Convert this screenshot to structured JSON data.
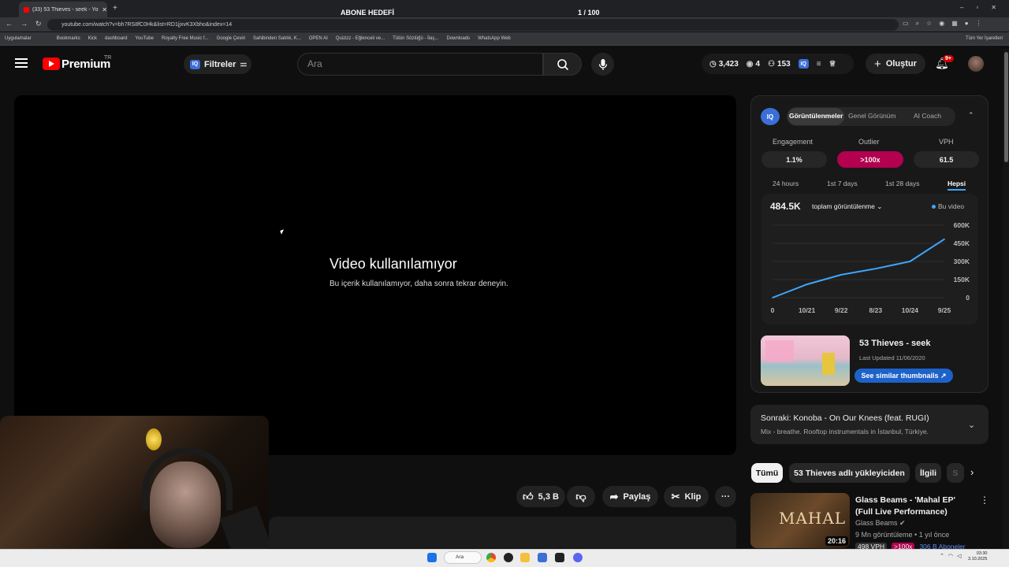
{
  "browser": {
    "tab_title": "(33) 53 Thieves - seek - YouTube",
    "url": "youtube.com/watch?v=bh7RS8fC0Hk&list=RD1jjxvK3Xbho&index=14",
    "bookmarks": [
      "Uygulamalar",
      "Bookmarks",
      "Kick",
      "dashboard",
      "YouTube",
      "Royalty Free Music f...",
      "Google Çeviri",
      "Sahibinden Satılık, K...",
      "OPEN AI",
      "Quizizz - Eğlenceli ve...",
      "Tütün Sözlüğü - İlaç...",
      "Downloads",
      "WhatsApp Web"
    ],
    "all_bookmarks": "Tüm Yer İşaretleri"
  },
  "overlay": {
    "title": "ABONE HEDEFİ",
    "count": "1  / 100",
    "progress": 0.01
  },
  "header": {
    "logo_text": "Premium",
    "region": "TR",
    "filters_label": "Filtreler",
    "iq_badge": "IQ",
    "search_placeholder": "Ara",
    "stats": {
      "views": "3,423",
      "eye": "4",
      "count": "153"
    },
    "create_label": "Oluştur",
    "notifications": "9+"
  },
  "player": {
    "title": "Video kullanılamıyor",
    "subtitle": "Bu içerik kullanılamıyor, daha sonra tekrar deneyin."
  },
  "actions": {
    "likes": "5,3 B",
    "share": "Paylaş",
    "clip": "Klip",
    "more": "···"
  },
  "iq_panel": {
    "logo": "IQ",
    "tabs": [
      "Görüntülenmeler",
      "Genel Görünüm",
      "AI Coach"
    ],
    "metrics": [
      {
        "label": "Engagement",
        "value": "1.1%"
      },
      {
        "label": "Outlier",
        "value": ">100x"
      },
      {
        "label": "VPH",
        "value": "61.5"
      }
    ],
    "ranges": [
      "24 hours",
      "1st 7 days",
      "1st 28 days",
      "Hepsi"
    ],
    "total": "484.5K",
    "metric_select": "toplam görüntülenme",
    "legend": "Bu video",
    "accent": "#3ea6ff",
    "outlier_color": "#b3004f"
  },
  "chart_data": {
    "type": "line",
    "x": [
      "0",
      "10/21",
      "9/22",
      "8/23",
      "10/24",
      "9/25"
    ],
    "y_ticks": [
      "600K",
      "450K",
      "300K",
      "150K",
      "0"
    ],
    "ylim": [
      0,
      600000
    ],
    "series": [
      {
        "name": "Bu video",
        "values": [
          0,
          110000,
          190000,
          240000,
          300000,
          484500
        ]
      }
    ],
    "grid": true
  },
  "thumbnail": {
    "title": "53 Thieves - seek",
    "updated": "Last Updated 11/06/2020",
    "similar": "See similar thumbnails ↗"
  },
  "next": {
    "title": "Sonraki: Konoba - On Our Knees (feat. RUGI)",
    "subtitle": "Mix - breathe. Rooftop instrumentals in İstanbul, Türkiye."
  },
  "chips": [
    "Tümü",
    "53 Thieves adlı yükleyiciden",
    "İlgili",
    "S"
  ],
  "recommendation": {
    "thumb_text": "MAHAL",
    "duration": "20:16",
    "title": "Glass Beams - 'Mahal EP' (Full Live Performance)",
    "channel": "Glass Beams",
    "meta": "9 Mn görüntüleme • 1 yıl önce",
    "badges": [
      "498 VPH",
      ">100x",
      "306 B Aboneler"
    ]
  },
  "taskbar": {
    "search": "Ara",
    "time": "03:30",
    "date": "3.10.2025"
  }
}
